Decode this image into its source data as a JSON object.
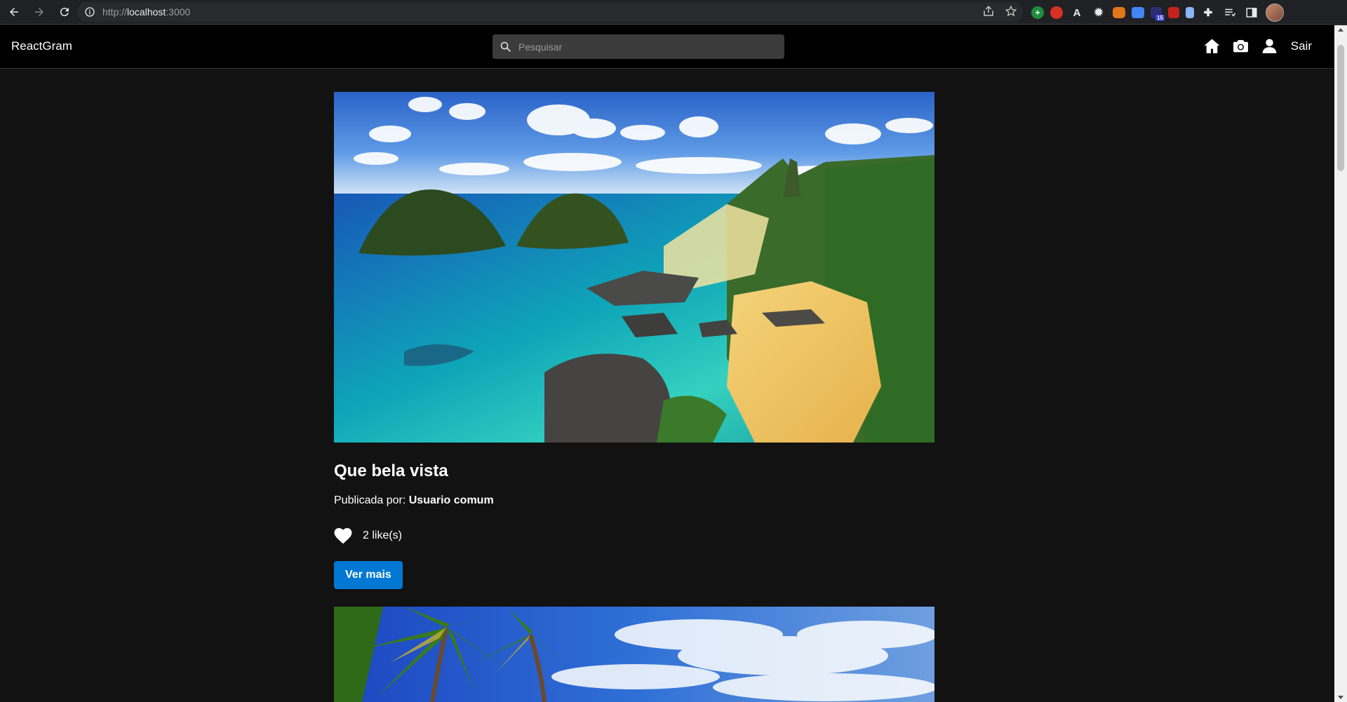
{
  "browser": {
    "url_prefix": "http://",
    "url_host": "localhost",
    "url_port": ":3000",
    "extension_badge": "15"
  },
  "navbar": {
    "brand": "ReactGram",
    "search_placeholder": "Pesquisar",
    "logout_label": "Sair"
  },
  "colors": {
    "page_bg": "#121212",
    "navbar_bg": "#000000",
    "button_blue": "#0078d4"
  },
  "posts": [
    {
      "title": "Que bela vista",
      "author_prefix": "Publicada por:",
      "author": "Usuario comum",
      "likes": "2 like(s)",
      "button": "Ver mais"
    }
  ]
}
